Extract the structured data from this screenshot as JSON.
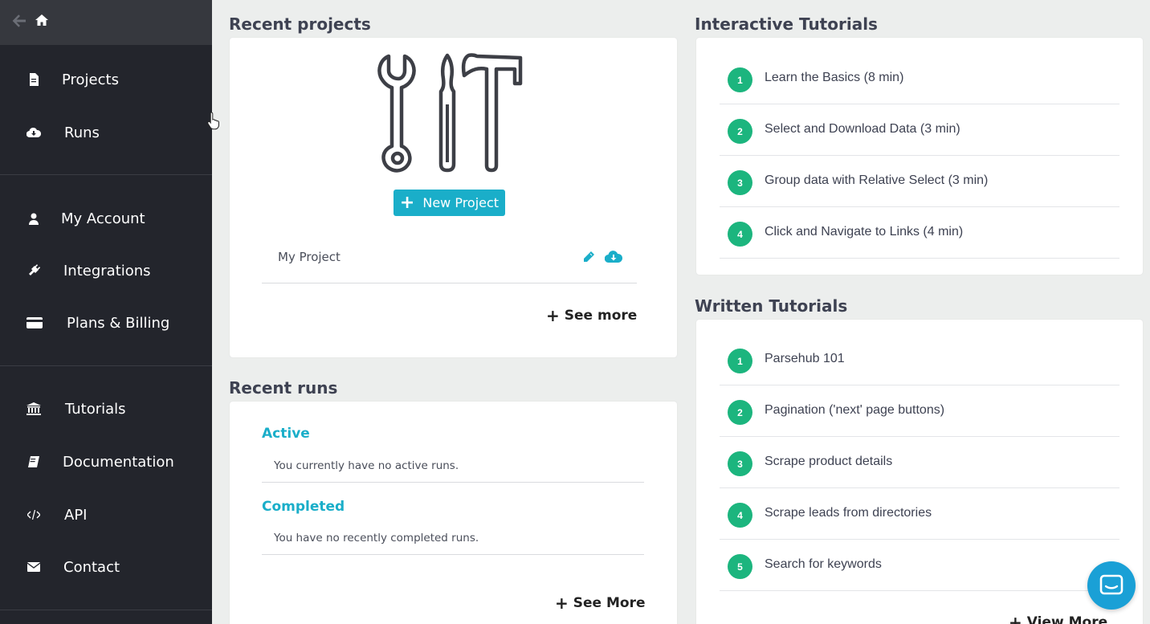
{
  "sidebar": {
    "items": [
      {
        "label": "Projects",
        "icon": "file-icon"
      },
      {
        "label": "Runs",
        "icon": "cloud-download-icon"
      },
      {
        "label": "My Account",
        "icon": "user-icon"
      },
      {
        "label": "Integrations",
        "icon": "plug-icon"
      },
      {
        "label": "Plans & Billing",
        "icon": "credit-card-icon"
      },
      {
        "label": "Tutorials",
        "icon": "institution-icon"
      },
      {
        "label": "Documentation",
        "icon": "book-icon"
      },
      {
        "label": "API",
        "icon": "code-icon"
      },
      {
        "label": "Contact",
        "icon": "envelope-icon"
      }
    ]
  },
  "recent_projects": {
    "title": "Recent projects",
    "new_project_label": "New Project",
    "projects": [
      {
        "name": "My Project"
      }
    ],
    "see_more_label": "See more"
  },
  "recent_runs": {
    "title": "Recent runs",
    "active_heading": "Active",
    "active_text": "You currently have no active runs.",
    "completed_heading": "Completed",
    "completed_text": "You have no recently completed runs.",
    "see_more_label": "See More"
  },
  "interactive_tutorials": {
    "title": "Interactive Tutorials",
    "items": [
      {
        "num": "1",
        "label": "Learn the Basics (8 min)"
      },
      {
        "num": "2",
        "label": "Select and Download Data (3 min)"
      },
      {
        "num": "3",
        "label": "Group data with Relative Select (3 min)"
      },
      {
        "num": "4",
        "label": "Click and Navigate to Links (4 min)"
      }
    ]
  },
  "written_tutorials": {
    "title": "Written Tutorials",
    "items": [
      {
        "num": "1",
        "label": "Parsehub 101"
      },
      {
        "num": "2",
        "label": "Pagination ('next' page buttons)"
      },
      {
        "num": "3",
        "label": "Scrape product details"
      },
      {
        "num": "4",
        "label": "Scrape leads from directories"
      },
      {
        "num": "5",
        "label": "Search for keywords"
      }
    ],
    "view_more_label": "View More"
  },
  "colors": {
    "accent": "#1aaec9",
    "tutorial_badge": "#1cb57e",
    "sidebar_bg": "#23252c",
    "chat": "#1aa0d6"
  }
}
